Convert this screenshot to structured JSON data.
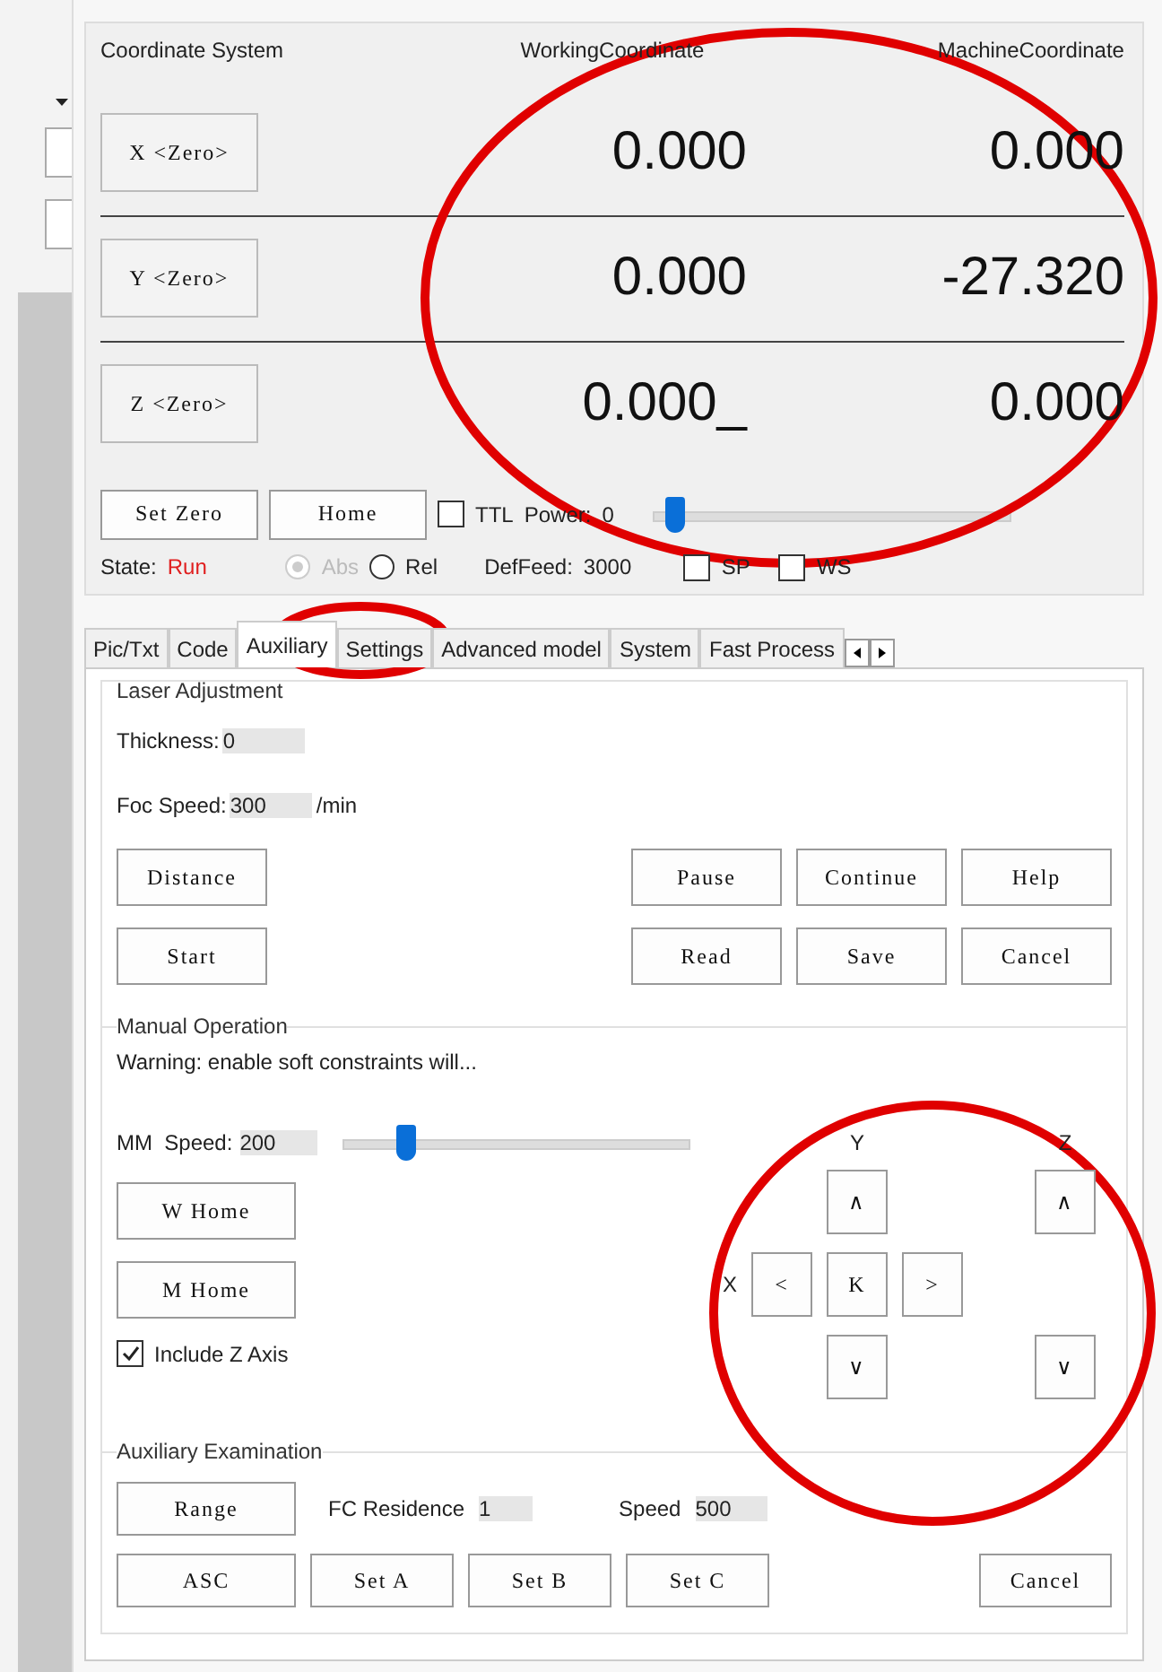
{
  "coordinates": {
    "headers": [
      "Coordinate System",
      "WorkingCoordinate",
      "MachineCoordinate"
    ],
    "rows": [
      {
        "button": "X <Zero>",
        "working": "0.000",
        "machine": "0.000"
      },
      {
        "button": "Y <Zero>",
        "working": "0.000",
        "machine": "-27.320"
      },
      {
        "button": "Z <Zero>",
        "working": "0.000_",
        "machine": "0.000"
      }
    ]
  },
  "controls": {
    "buttons": [
      "Set Zero",
      "Home"
    ],
    "ttl": {
      "label": "TTL",
      "checked": false
    },
    "power": {
      "label": "Power:",
      "value": "0",
      "level": 0.06
    }
  },
  "state": {
    "label": "State:",
    "value": "Run",
    "modes": [
      {
        "label": "Abs",
        "selected": true,
        "disabled": true
      },
      {
        "label": "Rel",
        "selected": false,
        "disabled": false
      }
    ],
    "deffeed": {
      "label": "DefFeed:",
      "value": "3000"
    },
    "options": [
      {
        "label": "SP",
        "checked": false
      },
      {
        "label": "WS",
        "checked": false
      }
    ]
  },
  "tabs": [
    {
      "label": "Pic/Txt",
      "selected": false
    },
    {
      "label": "Code",
      "selected": false
    },
    {
      "label": "Auxiliary",
      "selected": true
    },
    {
      "label": "Settings",
      "selected": false
    },
    {
      "label": "Advanced model",
      "selected": false
    },
    {
      "label": "System",
      "selected": false
    },
    {
      "label": "Fast Process",
      "selected": false
    }
  ],
  "laser_adjustment": {
    "title": "Laser Adjustment",
    "fields": [
      {
        "label": "Thickness:",
        "value": "0"
      },
      {
        "label": "Foc Speed:",
        "value": "300",
        "unit": "/min"
      }
    ],
    "rows": [
      {
        "left": "Distance",
        "right": [
          "Pause",
          "Continue",
          "Help"
        ]
      },
      {
        "left": "Start",
        "right": [
          "Read",
          "Save",
          "Cancel"
        ]
      }
    ]
  },
  "manual_operation": {
    "title": "Manual Operation",
    "warning": "Warning: enable soft constraints will...",
    "speed": {
      "label": "MM  Speed:",
      "value": "200",
      "level": 0.18
    },
    "buttons": [
      "W Home",
      "M Home"
    ],
    "include_z": {
      "label": "Include Z Axis",
      "checked": true
    },
    "jog": {
      "y_label": "Y",
      "z_label": "Z",
      "x_label": "X",
      "y_up": "∧",
      "x_left": "<",
      "center": "K",
      "x_right": ">",
      "y_down": "∨",
      "z_up": "∧",
      "z_down": "∨"
    }
  },
  "auxiliary_examination": {
    "title": "Auxiliary Examination",
    "range_button": "Range",
    "residence": {
      "label": "FC Residence",
      "value": "1"
    },
    "speed": {
      "label": "Speed",
      "value": "500"
    },
    "buttons": [
      "ASC",
      "Set A",
      "Set B",
      "Set C"
    ],
    "cancel": "Cancel"
  }
}
